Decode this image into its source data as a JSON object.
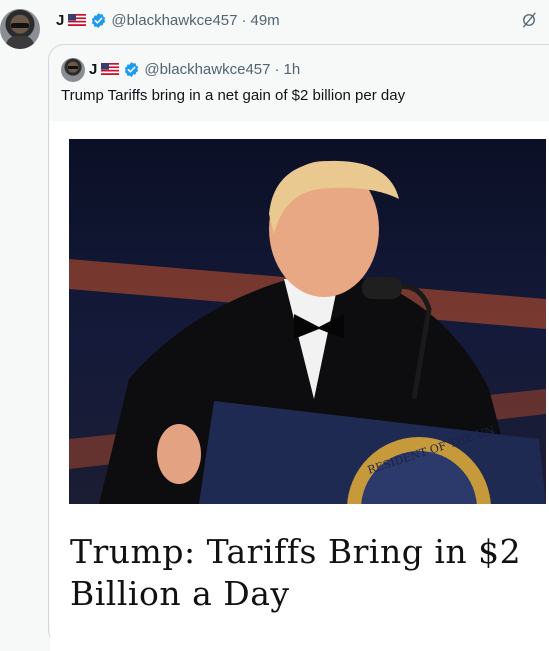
{
  "post": {
    "name": "J",
    "handle": "@blackhawkce457",
    "separator": "·",
    "time": "49m"
  },
  "quoted_post": {
    "name": "J",
    "handle": "@blackhawkce457",
    "separator": "·",
    "time": "1h",
    "text": "Trump Tariffs bring in a net gain of $2 billion per day"
  },
  "link_card": {
    "title": "Trump: Tariffs Bring in $2 Billion a Day",
    "seal_text": "RESIDENT OF THE UN"
  },
  "icons": {
    "verified": "verified-badge-icon",
    "flag": "us-flag-icon",
    "grok": "grok-icon"
  },
  "colors": {
    "verified_blue": "#1d9bf0",
    "secondary_text": "#536471",
    "border": "#cfd9de"
  }
}
